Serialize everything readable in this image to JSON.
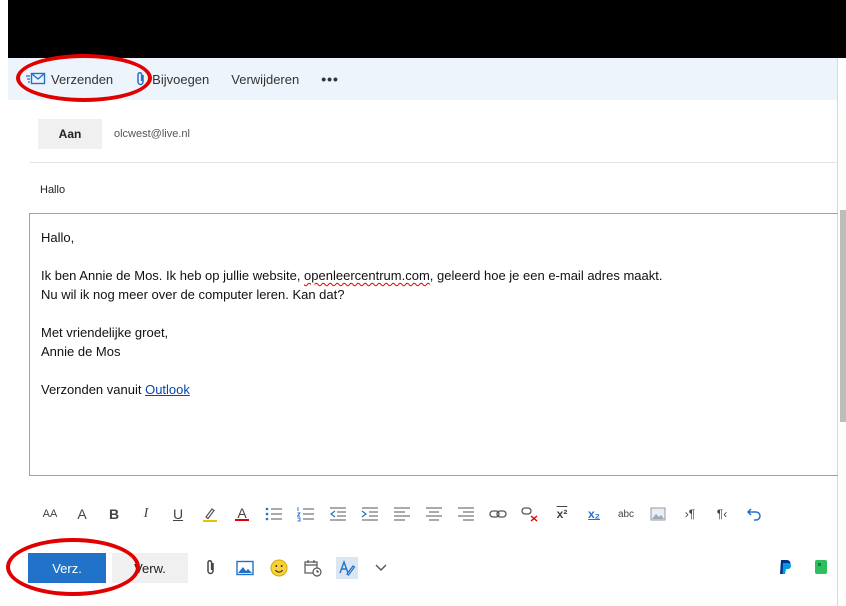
{
  "command_bar": {
    "send_label": "Verzenden",
    "attach_label": "Bijvoegen",
    "discard_label": "Verwijderen",
    "more_label": "•••"
  },
  "recipient": {
    "to_label": "Aan",
    "address": "olcwest@live.nl"
  },
  "subject": "Hallo",
  "message": {
    "greeting": "Hallo,",
    "line1_prefix": "Ik ben Annie de Mos. Ik heb op jullie website, ",
    "line1_site": "openleercentrum.com",
    "line1_suffix": ", geleerd hoe je een e-mail adres maakt.",
    "line2": "Nu wil ik nog meer over de computer leren. Kan dat?",
    "closing": "Met vriendelijke groet,",
    "signature": "Annie de Mos",
    "sent_from_prefix": "Verzonden vanuit ",
    "sent_from_link": "Outlook"
  },
  "format_toolbar": {
    "font_size_glyph": "AA",
    "grow_font_glyph": "A",
    "bold_glyph": "B",
    "italic_glyph": "I",
    "underline_glyph": "U",
    "font_color_glyph": "A",
    "superscript_glyph": "x²",
    "subscript_glyph": "x₂",
    "strikethrough_glyph": "abc",
    "ltr_glyph": "›¶",
    "rtl_glyph": "¶‹"
  },
  "bottom_bar": {
    "send_label": "Verz.",
    "discard_label": "Verw."
  },
  "colors": {
    "accent": "#2172c9",
    "annotation": "#e00000",
    "command_bar_bg": "#eef4fb"
  }
}
